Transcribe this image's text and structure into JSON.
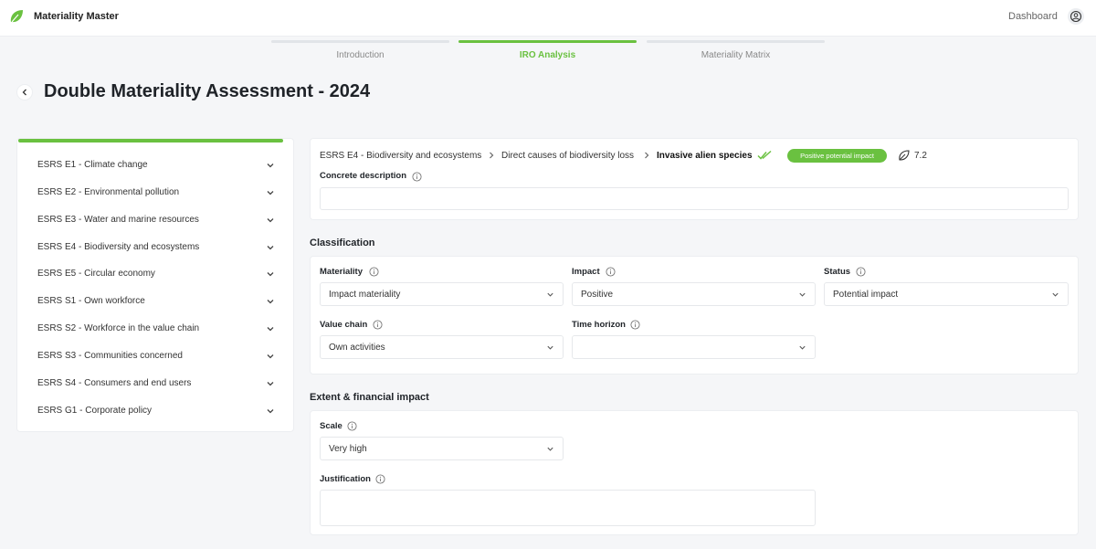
{
  "app": {
    "name": "Materiality Master",
    "dashboard_label": "Dashboard"
  },
  "steps": [
    {
      "label": "Introduction"
    },
    {
      "label": "IRO Analysis"
    },
    {
      "label": "Materiality Matrix"
    }
  ],
  "page": {
    "title": "Double Materiality Assessment - 2024"
  },
  "sidebar": {
    "items": [
      {
        "label": "ESRS E1 - Climate change"
      },
      {
        "label": "ESRS E2 - Environmental pollution"
      },
      {
        "label": "ESRS E3 - Water and marine resources"
      },
      {
        "label": "ESRS E4 - Biodiversity and ecosystems"
      },
      {
        "label": "ESRS E5 - Circular economy"
      },
      {
        "label": "ESRS S1 - Own workforce"
      },
      {
        "label": "ESRS S2 - Workforce in the value chain"
      },
      {
        "label": "ESRS S3 - Communities concerned"
      },
      {
        "label": "ESRS S4 - Consumers and end users"
      },
      {
        "label": "ESRS G1 - Corporate policy"
      }
    ]
  },
  "detail": {
    "breadcrumb": [
      "ESRS E4 - Biodiversity and ecosystems",
      "Direct causes of biodiversity loss",
      "Invasive alien species"
    ],
    "badge": "Positive potential impact",
    "comment_count": "7.2",
    "concrete_description_label": "Concrete description",
    "concrete_description_value": ""
  },
  "classification": {
    "title": "Classification",
    "materiality": {
      "label": "Materiality",
      "value": "Impact materiality"
    },
    "impact": {
      "label": "Impact",
      "value": "Positive"
    },
    "status": {
      "label": "Status",
      "value": "Potential impact"
    },
    "value_chain": {
      "label": "Value chain",
      "value": "Own activities"
    },
    "time_horizon": {
      "label": "Time horizon",
      "value": ""
    }
  },
  "extent": {
    "title": "Extent & financial impact",
    "scale": {
      "label": "Scale",
      "value": "Very high"
    },
    "justification": {
      "label": "Justification",
      "value": ""
    }
  },
  "colors": {
    "accent": "#6ac140",
    "background": "#f5f6f8"
  }
}
